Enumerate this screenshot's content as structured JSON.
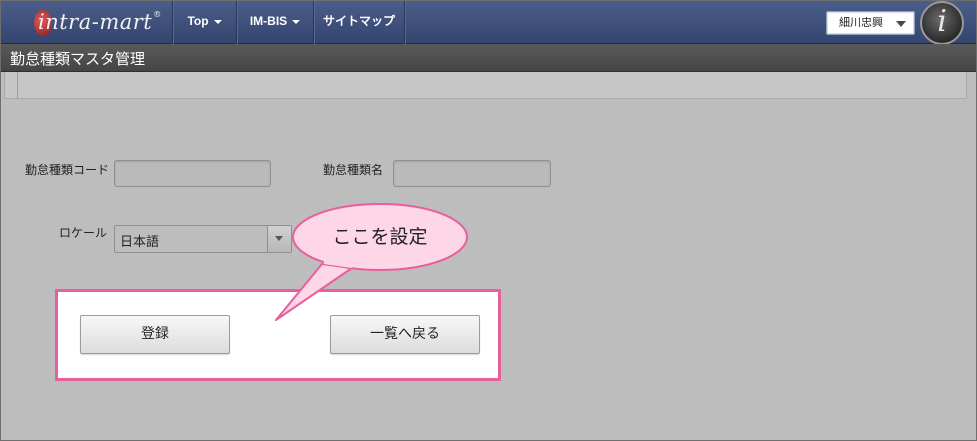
{
  "app": {
    "logo_text": "intra-mart",
    "logo_reg": "®",
    "brand_badge": "i"
  },
  "nav": {
    "items": [
      {
        "label": "Top",
        "dropdown": true
      },
      {
        "label": "IM-BIS",
        "dropdown": true
      },
      {
        "label": "サイトマップ",
        "dropdown": false
      }
    ],
    "user": "細川忠興"
  },
  "page": {
    "title": "勤怠種類マスタ管理"
  },
  "form": {
    "code_label": "勤怠種類コード",
    "code_value": "",
    "name_label": "勤怠種類名",
    "name_value": "",
    "locale_label": "ロケール",
    "locale_value": "日本語"
  },
  "actions": {
    "register_label": "登録",
    "back_label": "一覧へ戻る"
  },
  "annotation": {
    "callout_text": "ここを設定"
  },
  "colors": {
    "navbar": "#3d4e7c",
    "titlebar": "#4f4f4f",
    "background": "#bdbdbd",
    "highlight": "#e85f9d",
    "callout_fill": "#fdd6e8"
  }
}
